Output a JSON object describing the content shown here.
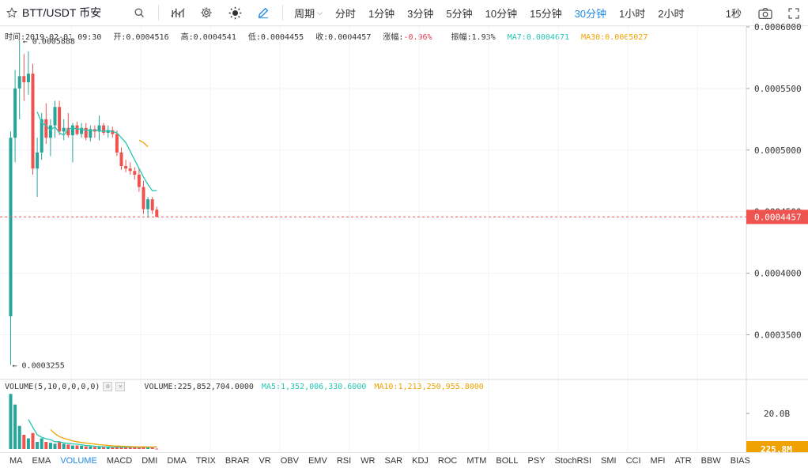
{
  "toolbar": {
    "symbol": "BTT/USDT 币安",
    "period_label": "周期",
    "intervals": [
      "分时",
      "1分钟",
      "3分钟",
      "5分钟",
      "10分钟",
      "15分钟",
      "30分钟",
      "1小时",
      "2小时"
    ],
    "active_interval": "30分钟",
    "right_label": "1秒"
  },
  "legend": {
    "time": "时间:2019-02-01 09:30",
    "open": "开:0.0004516",
    "high": "高:0.0004541",
    "low": "低:0.0004455",
    "close": "收:0.0004457",
    "change": "涨幅:-0.96%",
    "amplitude": "振幅:1.93%",
    "ma7": "MA7:0.0004671",
    "ma30": "MA30:0.0005027"
  },
  "volume_legend": {
    "name": "VOLUME(5,10,0,0,0,0)",
    "volume": "VOLUME:225,852,704.0000",
    "ma5": "MA5:1,352,006,330.6000",
    "ma10": "MA10:1,213,250,955.8000"
  },
  "indicators": [
    "MA",
    "EMA",
    "VOLUME",
    "MACD",
    "DMI",
    "DMA",
    "TRIX",
    "BRAR",
    "VR",
    "OBV",
    "EMV",
    "RSI",
    "WR",
    "SAR",
    "KDJ",
    "ROC",
    "MTM",
    "BOLL",
    "PSY",
    "StochRSI",
    "SMI",
    "CCI",
    "MFI",
    "ATR",
    "BBW",
    "BIAS"
  ],
  "active_indicator": "VOLUME",
  "colors": {
    "up": "#26a69a",
    "down": "#ef5350",
    "accent": "#1e88e5",
    "ma7": "#26c6b0",
    "ma30": "#f0a202",
    "price_tag": "#ef5350"
  },
  "chart_data": {
    "type": "candlestick",
    "interval": "30分钟",
    "y_axis_ticks": [
      "0.0006000",
      "0.0005500",
      "0.0005000",
      "0.0004500",
      "0.0004000",
      "0.0003500"
    ],
    "ylim": [
      0.000315,
      0.0006
    ],
    "current_price_label": "0.0004457",
    "current_price": 0.0004457,
    "max_label": "0.0005888",
    "max_value": 0.0005888,
    "min_label": "0.0003255",
    "min_value": 0.0003255,
    "candles": [
      {
        "o": 0.000365,
        "h": 0.000515,
        "l": 0.0003255,
        "c": 0.00051
      },
      {
        "o": 0.00051,
        "h": 0.000565,
        "l": 0.00049,
        "c": 0.00055
      },
      {
        "o": 0.00055,
        "h": 0.0005888,
        "l": 0.000525,
        "c": 0.00056
      },
      {
        "o": 0.00056,
        "h": 0.000578,
        "l": 0.00054,
        "c": 0.000555
      },
      {
        "o": 0.000555,
        "h": 0.00058,
        "l": 0.000545,
        "c": 0.000562
      },
      {
        "o": 0.000562,
        "h": 0.00057,
        "l": 0.00048,
        "c": 0.000485
      },
      {
        "o": 0.000485,
        "h": 0.00051,
        "l": 0.000462,
        "c": 0.000498
      },
      {
        "o": 0.000498,
        "h": 0.00053,
        "l": 0.000492,
        "c": 0.000525
      },
      {
        "o": 0.000525,
        "h": 0.000538,
        "l": 0.000505,
        "c": 0.00051
      },
      {
        "o": 0.00051,
        "h": 0.000525,
        "l": 0.000495,
        "c": 0.00052
      },
      {
        "o": 0.00052,
        "h": 0.00054,
        "l": 0.00051,
        "c": 0.000535
      },
      {
        "o": 0.000535,
        "h": 0.00054,
        "l": 0.000512,
        "c": 0.000515
      },
      {
        "o": 0.000515,
        "h": 0.000525,
        "l": 0.000508,
        "c": 0.000518
      },
      {
        "o": 0.000518,
        "h": 0.00053,
        "l": 0.00051,
        "c": 0.000512
      },
      {
        "o": 0.000512,
        "h": 0.000522,
        "l": 0.00049,
        "c": 0.00052
      },
      {
        "o": 0.00052,
        "h": 0.000523,
        "l": 0.000512,
        "c": 0.000513
      },
      {
        "o": 0.000513,
        "h": 0.000522,
        "l": 0.00051,
        "c": 0.000518
      },
      {
        "o": 0.000518,
        "h": 0.000522,
        "l": 0.000508,
        "c": 0.00051
      },
      {
        "o": 0.00051,
        "h": 0.00052,
        "l": 0.000507,
        "c": 0.000517
      },
      {
        "o": 0.000517,
        "h": 0.00052,
        "l": 0.00051,
        "c": 0.000515
      },
      {
        "o": 0.000515,
        "h": 0.000528,
        "l": 0.000508,
        "c": 0.00052
      },
      {
        "o": 0.00052,
        "h": 0.000522,
        "l": 0.000512,
        "c": 0.000514
      },
      {
        "o": 0.000514,
        "h": 0.00052,
        "l": 0.00051,
        "c": 0.000516
      },
      {
        "o": 0.000516,
        "h": 0.000519,
        "l": 0.00051,
        "c": 0.000513
      },
      {
        "o": 0.000513,
        "h": 0.000516,
        "l": 0.000495,
        "c": 0.000498
      },
      {
        "o": 0.000498,
        "h": 0.000502,
        "l": 0.000484,
        "c": 0.000487
      },
      {
        "o": 0.000487,
        "h": 0.000492,
        "l": 0.000482,
        "c": 0.000485
      },
      {
        "o": 0.000485,
        "h": 0.00049,
        "l": 0.00048,
        "c": 0.000483
      },
      {
        "o": 0.000483,
        "h": 0.000486,
        "l": 0.000476,
        "c": 0.00048
      },
      {
        "o": 0.00048,
        "h": 0.000485,
        "l": 0.000466,
        "c": 0.00047
      },
      {
        "o": 0.00047,
        "h": 0.000475,
        "l": 0.000448,
        "c": 0.000452
      },
      {
        "o": 0.000452,
        "h": 0.000462,
        "l": 0.000445,
        "c": 0.00046
      },
      {
        "o": 0.00046,
        "h": 0.000462,
        "l": 0.000448,
        "c": 0.000451
      },
      {
        "o": 0.0004516,
        "h": 0.0004541,
        "l": 0.0004455,
        "c": 0.0004457
      }
    ],
    "ma7": [
      null,
      null,
      null,
      null,
      null,
      null,
      0.000531,
      0.000522,
      0.00052,
      0.000516,
      0.000519,
      0.000514,
      0.000512,
      0.000517,
      0.000518,
      0.000517,
      0.000517,
      0.000516,
      0.000516,
      0.000516,
      0.000516,
      0.000515,
      0.000516,
      0.000515,
      0.000514,
      0.00051,
      0.000506,
      0.000499,
      0.000492,
      0.000485,
      0.000478,
      0.000472,
      0.000467,
      0.0004671
    ],
    "ma30": [
      null,
      null,
      null,
      null,
      null,
      null,
      null,
      null,
      null,
      null,
      null,
      null,
      null,
      null,
      null,
      null,
      null,
      null,
      null,
      null,
      null,
      null,
      null,
      null,
      null,
      null,
      null,
      null,
      null,
      0.000508,
      0.000506,
      0.0005027,
      null,
      null
    ],
    "volume": {
      "y_axis_ticks": [
        "20.0B"
      ],
      "current_label": "225.8M",
      "bars": [
        31.0,
        25.0,
        13.0,
        8.0,
        6.0,
        9.0,
        4.0,
        6.0,
        4.0,
        3.5,
        3.0,
        4.0,
        3.0,
        2.5,
        2.0,
        2.0,
        1.8,
        1.5,
        1.5,
        1.2,
        1.2,
        1.0,
        1.0,
        1.0,
        1.5,
        1.2,
        1.0,
        0.9,
        1.0,
        1.0,
        1.5,
        0.9,
        0.8,
        0.23
      ],
      "ma5": [
        null,
        null,
        null,
        null,
        16.6,
        12.2,
        8.0,
        6.6,
        5.8,
        5.3,
        4.1,
        4.1,
        3.5,
        3.2,
        2.9,
        2.7,
        2.3,
        2.0,
        1.8,
        1.6,
        1.4,
        1.3,
        1.2,
        1.1,
        1.1,
        1.1,
        1.1,
        1.1,
        1.1,
        1.0,
        1.1,
        1.1,
        1.0,
        1.35
      ],
      "ma10": [
        null,
        null,
        null,
        null,
        null,
        null,
        null,
        null,
        null,
        11.0,
        8.6,
        7.0,
        6.0,
        5.4,
        4.5,
        4.1,
        3.7,
        3.4,
        3.1,
        2.8,
        2.4,
        2.2,
        2.0,
        1.8,
        1.7,
        1.6,
        1.5,
        1.4,
        1.3,
        1.2,
        1.2,
        1.2,
        1.1,
        1.21
      ],
      "unit": "B",
      "ylim": [
        0,
        32
      ]
    }
  }
}
